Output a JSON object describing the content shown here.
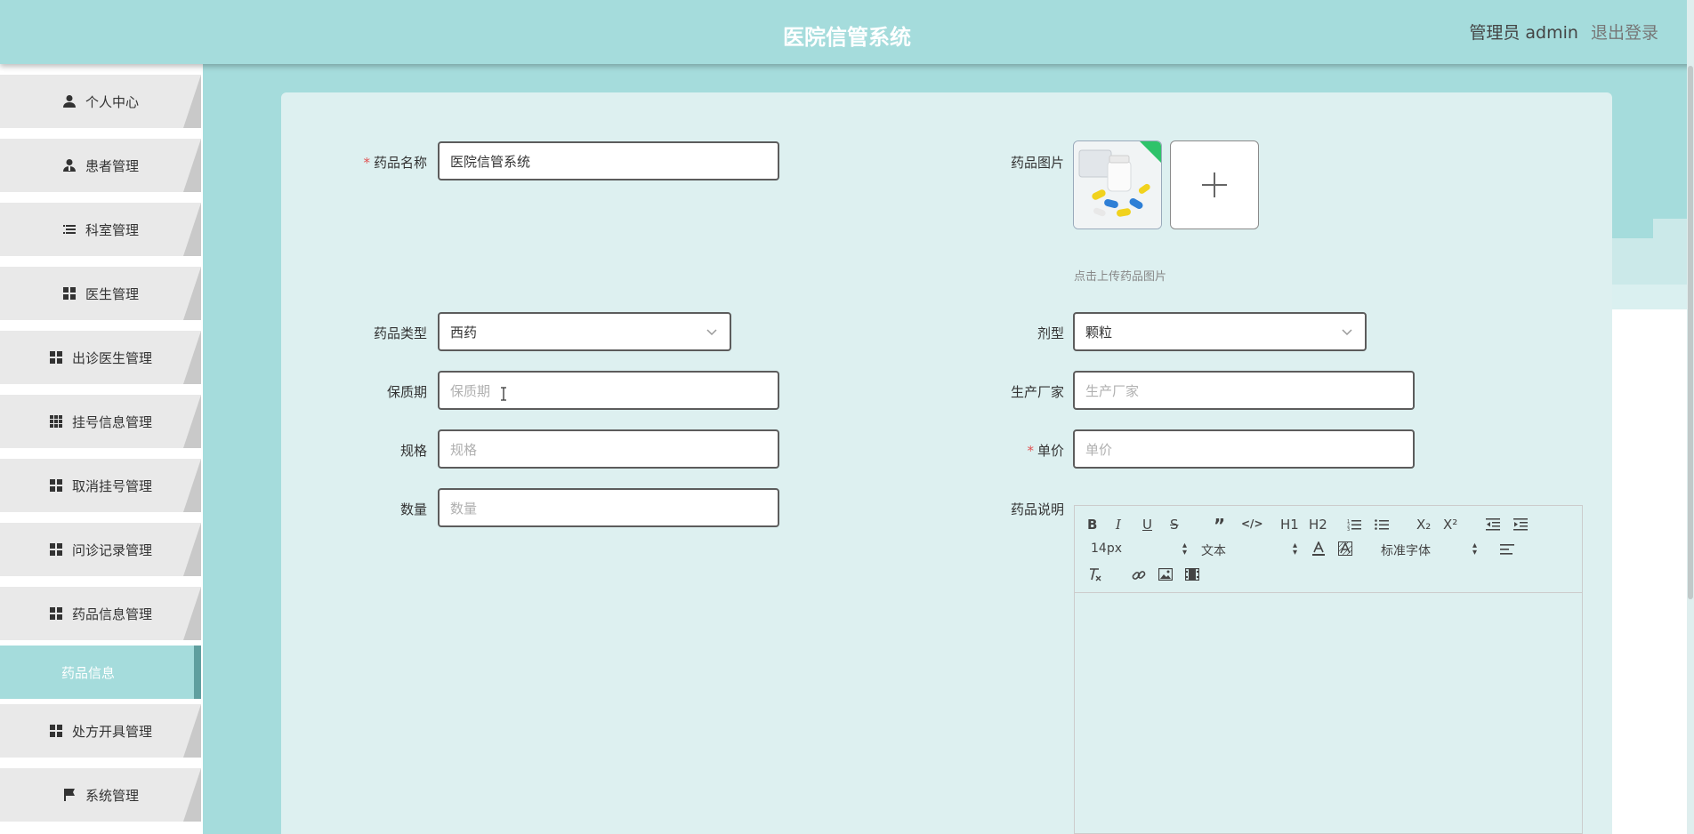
{
  "header": {
    "title": "医院信管系统",
    "user_role": "管理员 admin",
    "logout": "退出登录"
  },
  "sidebar": {
    "items": [
      {
        "label": "个人中心",
        "icon": "user-icon"
      },
      {
        "label": "患者管理",
        "icon": "user-tie-icon"
      },
      {
        "label": "科室管理",
        "icon": "list-icon"
      },
      {
        "label": "医生管理",
        "icon": "grid-icon"
      },
      {
        "label": "出诊医生管理",
        "icon": "grid-icon"
      },
      {
        "label": "挂号信息管理",
        "icon": "grid9-icon"
      },
      {
        "label": "取消挂号管理",
        "icon": "grid-icon"
      },
      {
        "label": "问诊记录管理",
        "icon": "grid-icon"
      },
      {
        "label": "药品信息管理",
        "icon": "grid-icon"
      },
      {
        "label": "药品信息",
        "icon": "",
        "active": true
      },
      {
        "label": "处方开具管理",
        "icon": "grid-icon"
      },
      {
        "label": "系统管理",
        "icon": "flag-icon"
      }
    ]
  },
  "form": {
    "name": {
      "label": "药品名称",
      "value": "医院信管系统",
      "required": true
    },
    "image": {
      "label": "药品图片",
      "hint": "点击上传药品图片"
    },
    "type": {
      "label": "药品类型",
      "value": "西药"
    },
    "dosage_form": {
      "label": "剂型",
      "value": "颗粒"
    },
    "shelf_life": {
      "label": "保质期",
      "placeholder": "保质期"
    },
    "manufacturer": {
      "label": "生产厂家",
      "placeholder": "生产厂家"
    },
    "spec": {
      "label": "规格",
      "placeholder": "规格"
    },
    "unit_price": {
      "label": "单价",
      "placeholder": "单价",
      "required": true
    },
    "quantity": {
      "label": "数量",
      "placeholder": "数量"
    },
    "description": {
      "label": "药品说明"
    }
  },
  "editor_toolbar": {
    "buttons": [
      "B",
      "I",
      "U",
      "S",
      "”",
      "</>",
      "H1",
      "H2",
      "ordered-list",
      "bullet-list",
      "X₂",
      "X²",
      "outdent",
      "indent"
    ],
    "font_size": "14px",
    "text_style": "文本",
    "font_family": "标准字体"
  },
  "colors": {
    "accent": "#a5dcdc",
    "card": "#ddf0f0",
    "required": "#e05252"
  }
}
